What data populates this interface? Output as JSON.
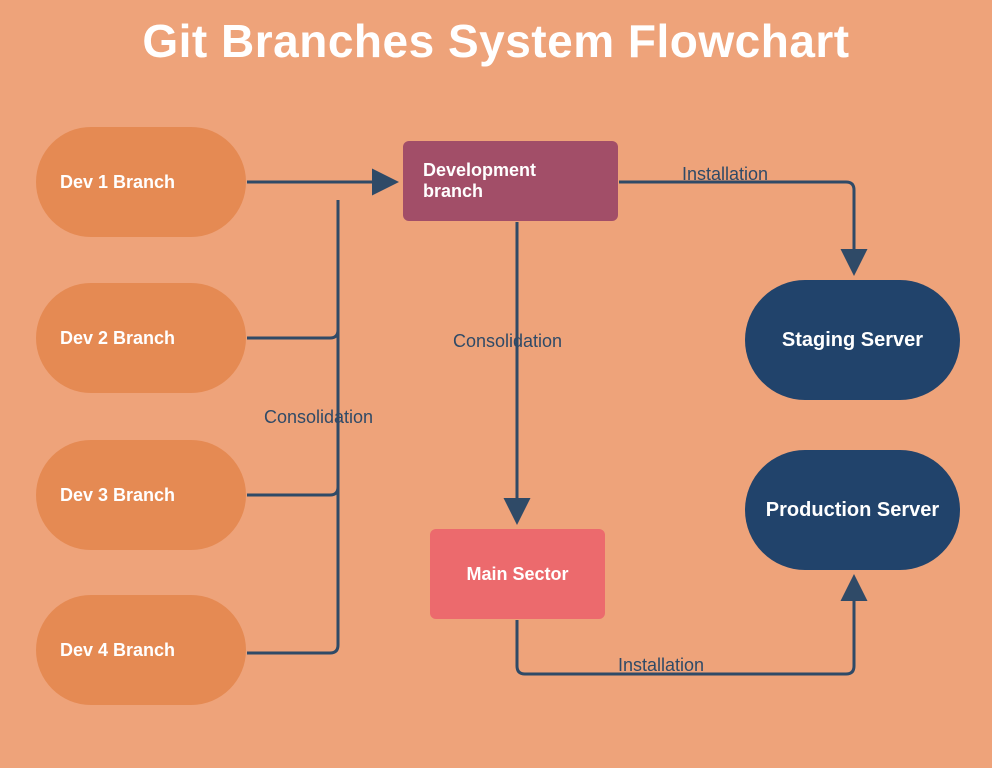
{
  "title": "Git Branches System Flowchart",
  "nodes": {
    "dev1": "Dev 1 Branch",
    "dev2": "Dev 2 Branch",
    "dev3": "Dev 3 Branch",
    "dev4": "Dev 4 Branch",
    "development": "Development branch",
    "main": "Main Sector",
    "staging": "Staging Server",
    "production": "Production Server"
  },
  "edges": {
    "consolidation1": "Consolidation",
    "consolidation2": "Consolidation",
    "installation1": "Installation",
    "installation2": "Installation"
  },
  "colors": {
    "bg": "#eea37a",
    "devBranch": "#e58a53",
    "devBox": "#a24e68",
    "mainBox": "#ec6a6d",
    "server": "#21436b",
    "arrow": "#2f4a67"
  }
}
